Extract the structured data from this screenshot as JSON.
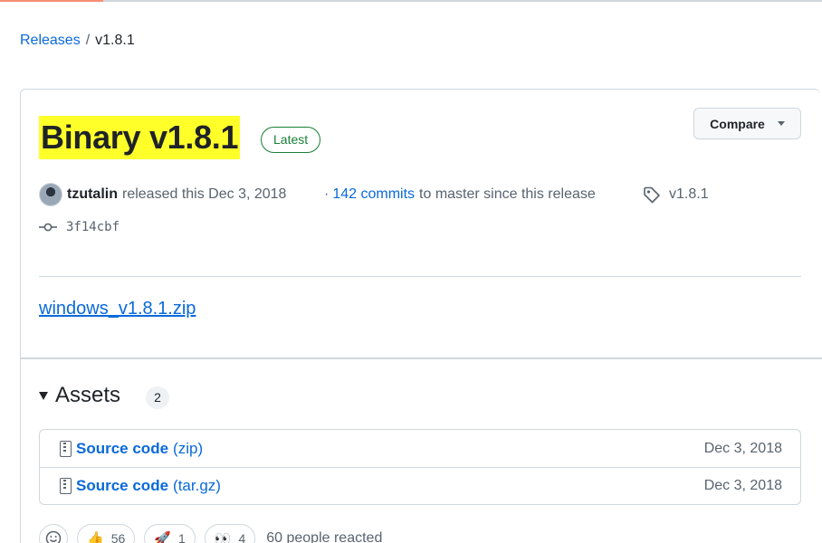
{
  "breadcrumb": {
    "releases": "Releases",
    "separator": "/",
    "current": "v1.8.1"
  },
  "release": {
    "title": "Binary v1.8.1",
    "badge": "Latest",
    "compare_label": "Compare",
    "author": "tzutalin",
    "released_text": "released this Dec 3, 2018",
    "commits_prefix": "·",
    "commits_link": "142 commits",
    "commits_suffix": "to master since this release",
    "tag": "v1.8.1",
    "commit_hash": "3f14cbf",
    "file_link": "windows_v1.8.1.zip"
  },
  "assets": {
    "title": "Assets",
    "count": "2",
    "items": [
      {
        "name": "Source code",
        "ext": "(zip)",
        "date": "Dec 3, 2018"
      },
      {
        "name": "Source code",
        "ext": "(tar.gz)",
        "date": "Dec 3, 2018"
      }
    ]
  },
  "reactions": {
    "thumbs_up": "56",
    "rocket": "1",
    "eyes": "4",
    "summary": "60 people reacted"
  },
  "colors": {
    "link": "#0969da",
    "latest": "#1a7f37",
    "highlight": "#ffff2a"
  }
}
